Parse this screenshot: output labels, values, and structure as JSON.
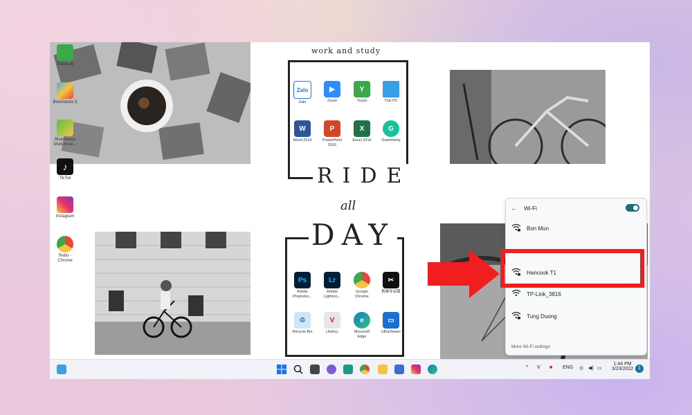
{
  "desktop_icons": [
    {
      "label": "TraceLab",
      "icon": "trace-app-icon",
      "color": "#3aa94a"
    },
    {
      "label": "BlueStacks 5",
      "icon": "bluestacks-icon",
      "color": "#45b0e6"
    },
    {
      "label": "BlueStacks Multi-Insta...",
      "icon": "bluestacks-multi-icon",
      "color": "#5ac04a"
    },
    {
      "label": "TikTok",
      "icon": "tiktok-icon",
      "color": "#111111"
    },
    {
      "label": "Instagram",
      "icon": "instagram-icon",
      "color": "#d3337a"
    },
    {
      "label": "Rebo - Chrome",
      "icon": "chrome-icon",
      "color": "#4285f4"
    }
  ],
  "banner": {
    "work_study": "work and study",
    "ride": "RIDE",
    "all": "all",
    "day": "DAY"
  },
  "work_apps": [
    {
      "label": "Zalo",
      "icon": "zalo-icon",
      "glyph": "Zalo",
      "color": "#ffffff",
      "text": "#1a73e8"
    },
    {
      "label": "Zoom",
      "icon": "zoom-icon",
      "glyph": "▶",
      "color": "#2d8cff",
      "text": "#ffffff"
    },
    {
      "label": "TruyG",
      "icon": "truyg-icon",
      "glyph": "Y",
      "color": "#3aa94a",
      "text": "#ffffff"
    },
    {
      "label": "This PC",
      "icon": "this-pc-icon",
      "glyph": "",
      "color": "#3aa0e6",
      "text": "#ffffff"
    },
    {
      "label": "Word 2016",
      "icon": "word-icon",
      "glyph": "W",
      "color": "#2b579a",
      "text": "#ffffff"
    },
    {
      "label": "PowerPoint 2016",
      "icon": "powerpoint-icon",
      "glyph": "P",
      "color": "#d24726",
      "text": "#ffffff"
    },
    {
      "label": "Excel 2016",
      "icon": "excel-icon",
      "glyph": "X",
      "color": "#217346",
      "text": "#ffffff"
    },
    {
      "label": "Grammarly",
      "icon": "grammarly-icon",
      "glyph": "G",
      "color": "#15c39a",
      "text": "#ffffff"
    }
  ],
  "day_apps": [
    {
      "label": "Adobe Photosho...",
      "icon": "photoshop-icon",
      "glyph": "Ps",
      "color": "#001e36",
      "text": "#31a8ff"
    },
    {
      "label": "Adobe Lightroo...",
      "icon": "lightroom-icon",
      "glyph": "Lr",
      "color": "#001e36",
      "text": "#31a8ff"
    },
    {
      "label": "Google Chrome",
      "icon": "chrome-icon",
      "glyph": "●",
      "color": "#4285f4",
      "text": "#fbbc05"
    },
    {
      "label": "剪映专业版",
      "icon": "capcut-icon",
      "glyph": "✂",
      "color": "#111111",
      "text": "#ffffff"
    },
    {
      "label": "Recycle Bin",
      "icon": "recycle-bin-icon",
      "glyph": "♻",
      "color": "#cfe7f5",
      "text": "#3a8ed0"
    },
    {
      "label": "UniKey",
      "icon": "unikey-icon",
      "glyph": "V",
      "color": "#e6e6e6",
      "text": "#d02020"
    },
    {
      "label": "Microsoft Edge",
      "icon": "edge-icon",
      "glyph": "e",
      "color": "#0f7dc8",
      "text": "#ffffff"
    },
    {
      "label": "UltraViewer",
      "icon": "ultraviewer-icon",
      "glyph": "▭",
      "color": "#1a6fd0",
      "text": "#ffffff"
    }
  ],
  "taskbar": {
    "pinned": [
      "widgets-icon",
      "windows-start-icon",
      "search-icon",
      "task-view-icon",
      "chat-icon",
      "app-icon",
      "chrome-icon",
      "file-explorer-icon",
      "store-icon",
      "instagram-icon",
      "edge-icon"
    ],
    "lang": "ENG",
    "time": "1:44 PM",
    "date": "3/23/2022",
    "notification_count": "1"
  },
  "wifi_panel": {
    "title": "Wi-Fi",
    "enabled": true,
    "networks": [
      {
        "name": "Bon Mun",
        "secured": true
      },
      {
        "name": "Hancook T1",
        "secured": true,
        "highlighted": true
      },
      {
        "name": "TP-Link_3816",
        "secured": false
      },
      {
        "name": "Tung Duong",
        "secured": true
      }
    ],
    "more_settings": "More Wi-Fi settings"
  },
  "colors": {
    "highlight": "#f01e1e",
    "toggle": "#1c6f79"
  }
}
